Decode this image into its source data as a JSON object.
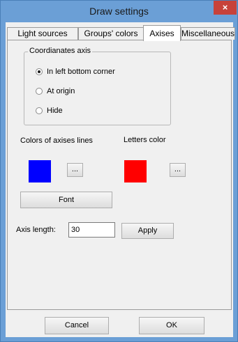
{
  "window": {
    "title": "Draw settings",
    "close_label": "×"
  },
  "tabs": [
    {
      "label": "Light sources",
      "active": false
    },
    {
      "label": "Groups' colors",
      "active": false
    },
    {
      "label": "Axises",
      "active": true
    },
    {
      "label": "Miscellaneous",
      "active": false
    }
  ],
  "coordinates_group": {
    "title": "Coordianates axis",
    "options": [
      {
        "label": "In left bottom corner",
        "checked": true
      },
      {
        "label": "At origin",
        "checked": false
      },
      {
        "label": "Hide",
        "checked": false
      }
    ]
  },
  "colors": {
    "axis_lines_label": "Colors of axises lines",
    "axis_lines_color": "#0000ff",
    "letters_label": "Letters color",
    "letters_color": "#ff0000",
    "picker_label": "..."
  },
  "font_button": "Font",
  "axis_length": {
    "label": "Axis length:",
    "value": "30",
    "apply_label": "Apply"
  },
  "footer": {
    "cancel_label": "Cancel",
    "ok_label": "OK"
  }
}
